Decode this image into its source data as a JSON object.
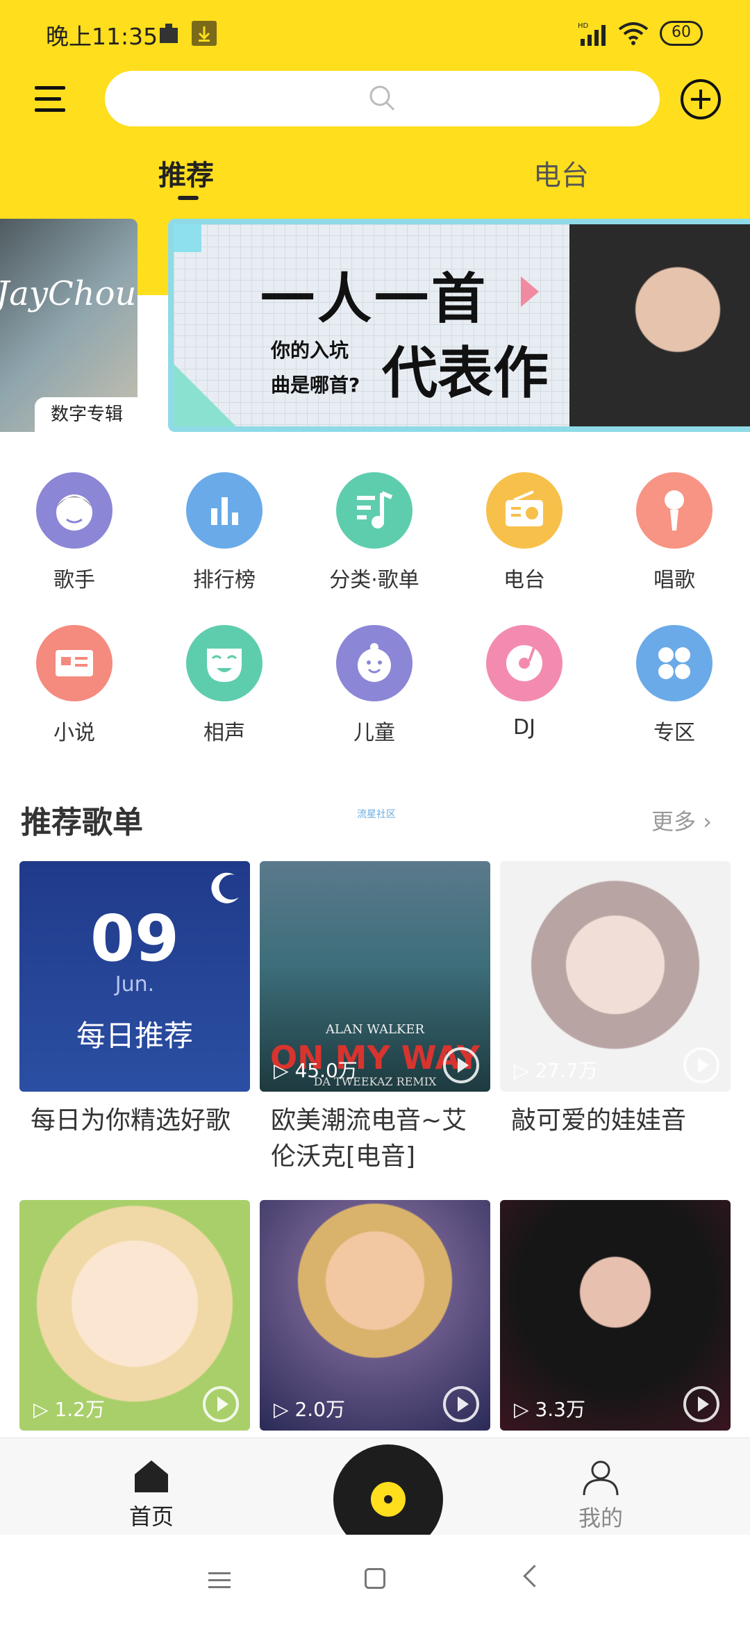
{
  "status_bar": {
    "time": "晚上11:35",
    "battery": "60"
  },
  "header": {
    "search_placeholder": ""
  },
  "tabs": [
    {
      "label": "推荐",
      "active": true
    },
    {
      "label": "电台",
      "active": false
    }
  ],
  "banner": {
    "left_tag": "数字专辑",
    "left_script": "JayChou",
    "headline": "一人一首",
    "sub_line1": "你的入坑",
    "sub_line2": "曲是哪首?",
    "big_text": "代表作"
  },
  "categories": [
    {
      "label": "歌手",
      "icon": "singer-icon",
      "color": "#8B86D6"
    },
    {
      "label": "排行榜",
      "icon": "chart-icon",
      "color": "#6AAAE8"
    },
    {
      "label": "分类·歌单",
      "icon": "playlist-icon",
      "color": "#5ECDAE"
    },
    {
      "label": "电台",
      "icon": "radio-icon",
      "color": "#F7C04A"
    },
    {
      "label": "唱歌",
      "icon": "microphone-icon",
      "color": "#F79484"
    },
    {
      "label": "小说",
      "icon": "book-icon",
      "color": "#F58A7E"
    },
    {
      "label": "相声",
      "icon": "mask-icon",
      "color": "#5ECDAE"
    },
    {
      "label": "儿童",
      "icon": "child-icon",
      "color": "#8B86D6"
    },
    {
      "label": "DJ",
      "icon": "dj-disc-icon",
      "color": "#F38BB0"
    },
    {
      "label": "专区",
      "icon": "grid-icon",
      "color": "#6AAAE8"
    }
  ],
  "section": {
    "title": "推荐歌单",
    "tag": "流星社区",
    "more": "更多"
  },
  "playlists": [
    {
      "title": "每日为你精选好歌",
      "count": "",
      "day": "09",
      "month": "Jun.",
      "daily_label": "每日推荐"
    },
    {
      "title": "欧美潮流电音~艾伦沃克[电音]",
      "count": "45.0万",
      "cover_text1": "ALAN WALKER",
      "cover_text2": "ON MY WAY",
      "cover_text3": "DA TWEEKAZ REMIX"
    },
    {
      "title": "敲可爱的娃娃音",
      "count": "27.7万"
    },
    {
      "title": "",
      "count": "1.2万"
    },
    {
      "title": "",
      "count": "2.0万"
    },
    {
      "title": "",
      "count": "3.3万"
    }
  ],
  "bottom_nav": {
    "home": "首页",
    "mine": "我的"
  }
}
